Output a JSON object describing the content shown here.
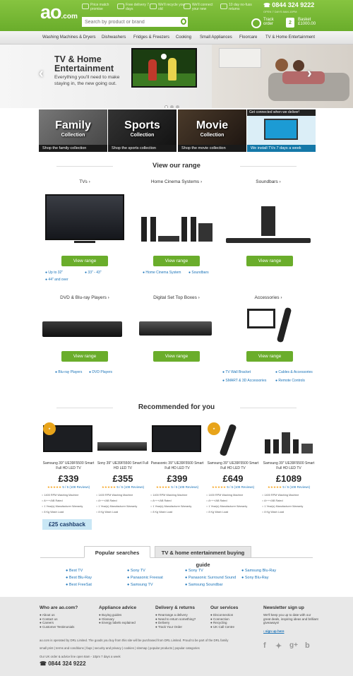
{
  "header": {
    "logo": "ao",
    "logo_suffix": ".com",
    "usps": [
      "Price match promise",
      "Free delivery 7 days",
      "We'll recycle your old",
      "We'll connect your new",
      "10 day no-fuss returns"
    ],
    "phone": "0844 324 9222",
    "phone_note": "OPEN 7 DAYS 8AM-10PM",
    "search_placeholder": "Search by product or brand",
    "track_label": "Track order",
    "basket_count": "2",
    "basket_label": "Basket",
    "basket_total": "£1000.00"
  },
  "nav": [
    "Washing Machines & Dryers",
    "Dishwashers",
    "Fridges & Freezers",
    "Cooking",
    "Small Appliances",
    "Floorcare",
    "TV & Home Entertainment"
  ],
  "hero": {
    "title": "TV & Home Entertainment",
    "subtitle": "Everything you'll need to make staying in, the new going out."
  },
  "tiles": [
    {
      "title": "Family",
      "sub": "Collection",
      "link": "Shop the family collection"
    },
    {
      "title": "Sports",
      "sub": "Collection",
      "link": "Shop the sports collection"
    },
    {
      "title": "Movie",
      "sub": "Collection",
      "link": "Shop the movie collection"
    },
    {
      "title": "Get connected when we deliver!",
      "sub": "",
      "link": "We install TVs 7 days a week"
    }
  ],
  "range": {
    "title": "View our range",
    "button": "View range",
    "categories": [
      {
        "name": "TVs",
        "links": [
          "Up to 32\"",
          "33\" - 43\"",
          "44\" and over"
        ]
      },
      {
        "name": "Home Cinema Systems",
        "links": [
          "Home Cinema System",
          "Soundbars"
        ]
      },
      {
        "name": "Soundbars",
        "links": []
      },
      {
        "name": "DVD & Blu-ray Players",
        "links": [
          "Blu-ray Players",
          "DVD Players"
        ]
      },
      {
        "name": "Digital Set Top Boxes",
        "links": []
      },
      {
        "name": "Accessories",
        "links": [
          "TV Wall Bracket",
          "Cables & Accessories",
          "SMART & 3D Accessories",
          "Remote Controls"
        ]
      }
    ]
  },
  "recommended": {
    "title": "Recommended for you",
    "products": [
      {
        "name": "Samsung 39\" UE39F5500 Smart Full HD LED TV",
        "price": "£339",
        "rating": "5 / 5 (108 Reviews)"
      },
      {
        "name": "Sony 39\" UE39F5500 Smart Full HD LED TV",
        "price": "£355",
        "rating": "5 / 5 (108 Reviews)"
      },
      {
        "name": "Panasonic 39\" UE39F5500 Smart Full HD LED TV",
        "price": "£399",
        "rating": "5 / 5 (108 Reviews)"
      },
      {
        "name": "Samsung 39\" UE39F5500 Smart Full HD LED TV",
        "price": "£649",
        "rating": "5 / 5 (108 Reviews)"
      },
      {
        "name": "Samsung 39\" UE39F5500 Smart Full HD LED TV",
        "price": "£1089",
        "rating": "5 / 5 (108 Reviews)"
      }
    ],
    "features": [
      "1400 RPM Washing Machine",
      "A+++/AB Rated",
      "1 Year(s) Manufacturer Warranty",
      "8 Kg Wash Load"
    ],
    "cashback": "£25 cashback"
  },
  "searches": {
    "tabs": [
      "Popular searches",
      "TV & home entertainment buying guide"
    ],
    "links": [
      "Best TV",
      "Best Blu-Ray",
      "Best FreeSat",
      "Sony TV",
      "Panasonic Freesat",
      "Samsung TV",
      "Sony TV",
      "Panasonic Surround Sound",
      "Samsung Soundbar",
      "Samsung Blu-Ray",
      "Sony Blu-Ray"
    ]
  },
  "footer": {
    "cols": [
      {
        "title": "Who are ao.com?",
        "links": [
          "About us",
          "Contact us",
          "Careers",
          "Customer Testimonials"
        ]
      },
      {
        "title": "Appliance advice",
        "links": [
          "Buying guides",
          "Glossary",
          "Energy labels explained"
        ]
      },
      {
        "title": "Delivery & returns",
        "links": [
          "Rearrange a delivery",
          "Need to return something?",
          "Delivery",
          "Track Your Order"
        ]
      },
      {
        "title": "Our services",
        "links": [
          "Disconnection",
          "Connection",
          "Recycling",
          "UK Call Centre"
        ]
      }
    ],
    "newsletter_title": "Newsletter sign up",
    "newsletter_text": "We'll keep you up to date with our great deals, inspiring ideas and brilliant giveaways!",
    "newsletter_link": "› sign up here",
    "legal": "ao.com is operated by DRL Limited. The goods you buy from this site will be purchased from DRL Limited. Proud to be part of the DRL family",
    "links_line": "small print | terms and conditions | faqs | security and privacy | cookies | sitemap | popular products | popular categories",
    "hours": "Our UK order & advice line open 8am - 10pm 7 days a week",
    "phone": "0844 324 9222"
  }
}
